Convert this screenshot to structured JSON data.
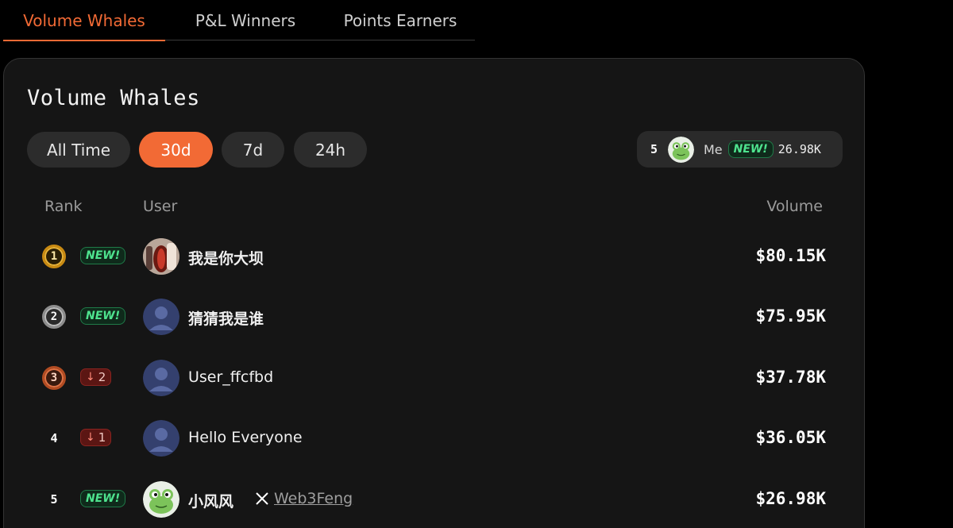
{
  "tabs": [
    {
      "label": "Volume Whales",
      "active": true
    },
    {
      "label": "P&L Winners",
      "active": false
    },
    {
      "label": "Points Earners",
      "active": false
    }
  ],
  "card": {
    "title": "Volume Whales",
    "filters": [
      {
        "label": "All Time",
        "active": false
      },
      {
        "label": "30d",
        "active": true
      },
      {
        "label": "7d",
        "active": false
      },
      {
        "label": "24h",
        "active": false
      }
    ],
    "me": {
      "rank": "5",
      "name": "Me",
      "badge": "NEW!",
      "value": "26.98K",
      "avatar_icon": "frog-avatar-icon"
    }
  },
  "table": {
    "headers": {
      "rank": "Rank",
      "user": "User",
      "volume": "Volume"
    },
    "rows": [
      {
        "rank": "1",
        "medal": "gold",
        "change": "NEW!",
        "change_type": "new",
        "avatar": "photo-avatar",
        "user": "我是你大坝",
        "volume": "$80.15K"
      },
      {
        "rank": "2",
        "medal": "silver",
        "change": "NEW!",
        "change_type": "new",
        "avatar": "default-user-icon",
        "user": "猜猜我是谁",
        "volume": "$75.95K"
      },
      {
        "rank": "3",
        "medal": "bronze",
        "change": "2",
        "change_type": "down",
        "avatar": "default-user-icon",
        "user": "User_ffcfbd",
        "volume": "$37.78K"
      },
      {
        "rank": "4",
        "medal": "none",
        "change": "1",
        "change_type": "down",
        "avatar": "default-user-icon",
        "user": "Hello Everyone",
        "volume": "$36.05K"
      },
      {
        "rank": "5",
        "medal": "none",
        "change": "NEW!",
        "change_type": "new",
        "avatar": "frog-avatar-icon",
        "user": "小风风",
        "x_handle": "Web3Feng",
        "volume": "$26.98K"
      }
    ]
  },
  "colors": {
    "accent": "#f26a35",
    "new_green": "#4ee38e",
    "down_red": "#ff8a7a",
    "card_bg": "#151515"
  }
}
